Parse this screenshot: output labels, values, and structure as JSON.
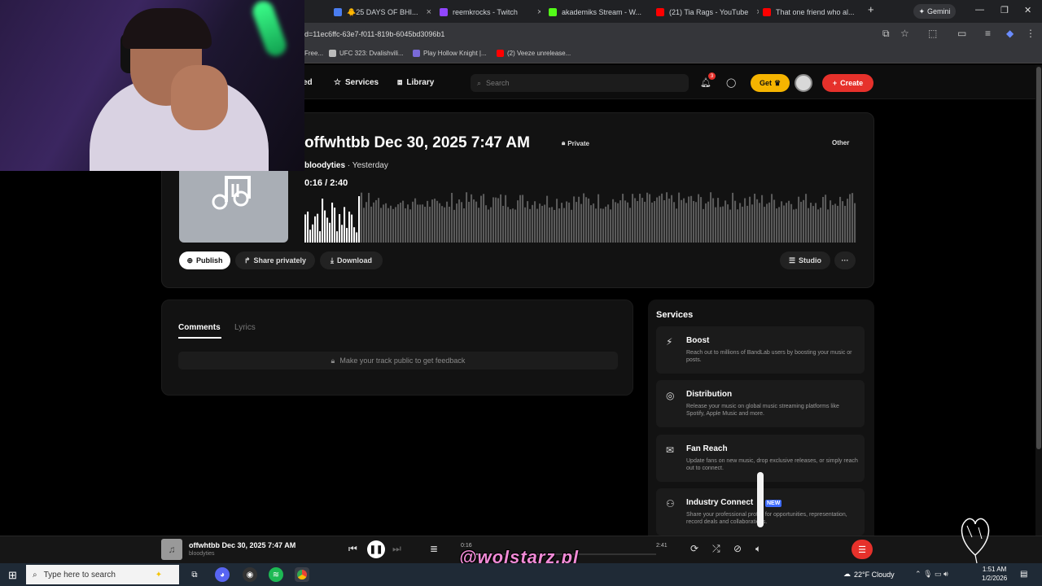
{
  "browser": {
    "tabs": [
      {
        "label": "🐥25 DAYS OF BHI...",
        "color": "#4a7df0"
      },
      {
        "label": "reemkrocks - Twitch",
        "color": "#9146ff"
      },
      {
        "label": "akademiks Stream - W...",
        "color": "#53fc18"
      },
      {
        "label": "(21) Tia Rags - YouTube",
        "color": "#ff0000"
      },
      {
        "label": "That one friend who al...",
        "color": "#ff0000"
      }
    ],
    "gemini_label": "Gemini",
    "url": "id=11ec6ffc-63e7-f011-819b-6045bd3096b1",
    "bookmarks": [
      {
        "label": "Free...",
        "color": "#888888"
      },
      {
        "label": "UFC 323: Dvalishvili...",
        "color": "#bbbbbb"
      },
      {
        "label": "Play Hollow Knight |...",
        "color": "#7a6ad8"
      },
      {
        "label": "(2) Veeze unrelease...",
        "color": "#ff0000"
      }
    ]
  },
  "header": {
    "nav_feed_partial": "ed",
    "nav_services": "Services",
    "nav_library": "Library",
    "search_placeholder": "Search",
    "notification_count": "3",
    "get_label": "Get",
    "create_label": "Create"
  },
  "track": {
    "title": "offwhtbb Dec 30, 2025 7:47 AM",
    "privacy": "Private",
    "genre": "Other",
    "artist": "bloodyties",
    "posted": "· Yesterday",
    "elapsed": "0:16",
    "duration": "2:40",
    "played_fraction": 0.1,
    "actions": {
      "publish": "Publish",
      "share": "Share privately",
      "download": "Download",
      "studio": "Studio"
    }
  },
  "comments": {
    "tab_comments": "Comments",
    "tab_lyrics": "Lyrics",
    "notice": "Make your track public to get feedback"
  },
  "services": {
    "heading": "Services",
    "items": [
      {
        "title": "Boost",
        "desc": "Reach out to millions of BandLab users by boosting your music or posts.",
        "icon": "bolt-icon"
      },
      {
        "title": "Distribution",
        "desc": "Release your music on global music streaming platforms like Spotify, Apple Music and more.",
        "icon": "distribution-icon"
      },
      {
        "title": "Fan Reach",
        "desc": "Update fans on new music, drop exclusive releases, or simply reach out to connect.",
        "icon": "mail-icon"
      },
      {
        "title": "Industry Connect",
        "desc": "Share your professional profile for opportunities, representation, record deals and collaborations.",
        "icon": "people-icon"
      }
    ],
    "new_badge": "NEW"
  },
  "player": {
    "title": "offwhtbb Dec 30, 2025 7:47 AM",
    "artist": "bloodyties",
    "elapsed": "0:16",
    "duration": "2:41",
    "progress_fraction": 0.1
  },
  "overlay": {
    "watermark": "@wolstarz.pl"
  },
  "taskbar": {
    "search_placeholder": "Type here to search",
    "weather": "22°F  Cloudy",
    "time": "1:51 AM",
    "date": "1/2/2026"
  },
  "colors": {
    "accent_red": "#e6312b",
    "get_yellow": "#f5b400",
    "background": "#000000",
    "card": "#121212"
  }
}
